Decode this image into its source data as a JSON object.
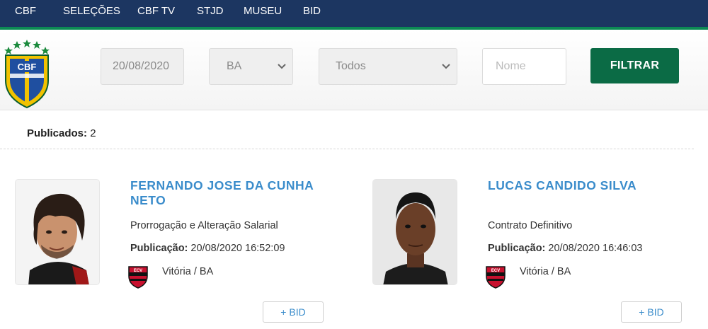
{
  "nav": {
    "items": [
      {
        "label": "CBF"
      },
      {
        "label": "SELEÇÕES"
      },
      {
        "label": "CBF TV"
      },
      {
        "label": "STJD"
      },
      {
        "label": "MUSEU"
      },
      {
        "label": "BID"
      }
    ]
  },
  "brand": {
    "logo_text": "CBF",
    "logo_icon": "cbf-crest-icon"
  },
  "filters": {
    "date_value": "20/08/2020",
    "state_value": "BA",
    "type_value": "Todos",
    "name_placeholder": "Nome",
    "submit_label": "FILTRAR"
  },
  "results": {
    "count_label": "Publicados:",
    "count_value": "2"
  },
  "players": [
    {
      "name": "FERNANDO JOSE DA CUNHA NETO",
      "contract_type": "Prorrogação e Alteração Salarial",
      "pub_label": "Publicação:",
      "pub_value": "20/08/2020 16:52:09",
      "club": "Vitória / BA",
      "bid_label": "+ BID"
    },
    {
      "name": "LUCAS CANDIDO SILVA",
      "contract_type": "Contrato Definitivo",
      "pub_label": "Publicação:",
      "pub_value": "20/08/2020 16:46:03",
      "club": "Vitória / BA",
      "bid_label": "+ BID"
    }
  ],
  "colors": {
    "nav_bg": "#1c3661",
    "nav_accent": "#0c8a54",
    "filter_button": "#0b6b45",
    "player_name": "#3a8ccb"
  }
}
